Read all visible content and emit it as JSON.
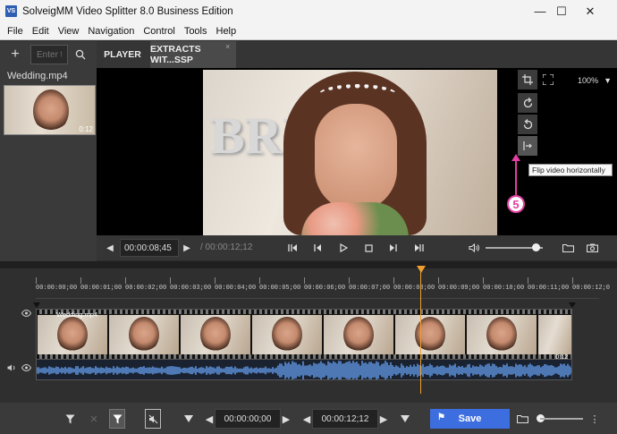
{
  "window": {
    "icon_text": "VS",
    "title": "SolveigMM Video Splitter 8.0 Business Edition",
    "minimize": "—",
    "maximize": "☐",
    "close": "✕"
  },
  "menu": [
    "File",
    "Edit",
    "View",
    "Navigation",
    "Control",
    "Tools",
    "Help"
  ],
  "library": {
    "add": "+",
    "search_placeholder": "Enter t",
    "file_name": "Wedding.mp4",
    "thumb_duration": "0:12"
  },
  "tabs": {
    "player": "PLAYER",
    "extracts": "EXTRACTS WIT...SSP",
    "close": "×"
  },
  "video": {
    "balloon_text": "BRI"
  },
  "video_tools": {
    "zoom": "100%",
    "zoom_arrow": "▼",
    "crop_icon": "crop-icon",
    "fullscreen_icon": "fullscreen-icon",
    "rotate_cw_icon": "rotate-cw-icon",
    "rotate_ccw_icon": "rotate-ccw-icon",
    "flip_icon": "flip-horizontal-icon"
  },
  "tooltip": "Flip video horizontally",
  "callout": "5",
  "player_controls": {
    "prev": "◀",
    "current_time": "00:00:08;45",
    "next": "▶",
    "total_time": "/ 00:00:12;12"
  },
  "timeline": {
    "ticks": [
      "00:00:00;00",
      "00:00:01;00",
      "00:00:02;00",
      "00:00:03;00",
      "00:00:04;00",
      "00:00:05;00",
      "00:00:06;00",
      "00:00:07;00",
      "00:00:08;00",
      "00:00:09;00",
      "00:00:10;00",
      "00:00:11;00",
      "00:00:12;0"
    ],
    "track_label": "Wedding.mp4",
    "track_end_label": "0:12"
  },
  "bottom": {
    "start_time": "00:00:00;00",
    "end_time": "00:00:12;12",
    "save": "Save",
    "more": "⋮"
  },
  "colors": {
    "accent": "#3d6ee0",
    "playhead": "#f0a030",
    "callout": "#e040a0",
    "waveform": "#5b8fd6"
  }
}
